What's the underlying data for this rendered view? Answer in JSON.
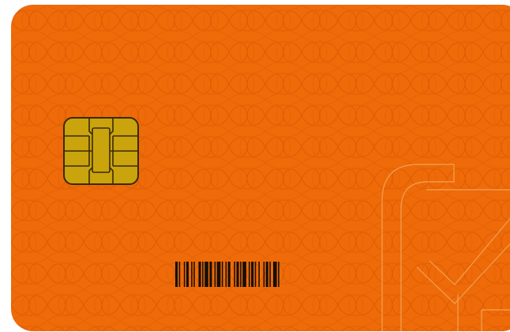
{
  "card": {
    "background_color": "#ef6a08",
    "pattern_color": "#dd5e06",
    "chip": {
      "icon": "emv-chip-icon",
      "gold_color": "#c9a40c",
      "outline_color": "#3a2a05"
    },
    "barcode": {
      "icon": "barcode-icon",
      "bar_color": "#151007"
    },
    "logo": {
      "icon": "checkmark-logo-icon",
      "stroke_color": "#f3a657"
    }
  }
}
